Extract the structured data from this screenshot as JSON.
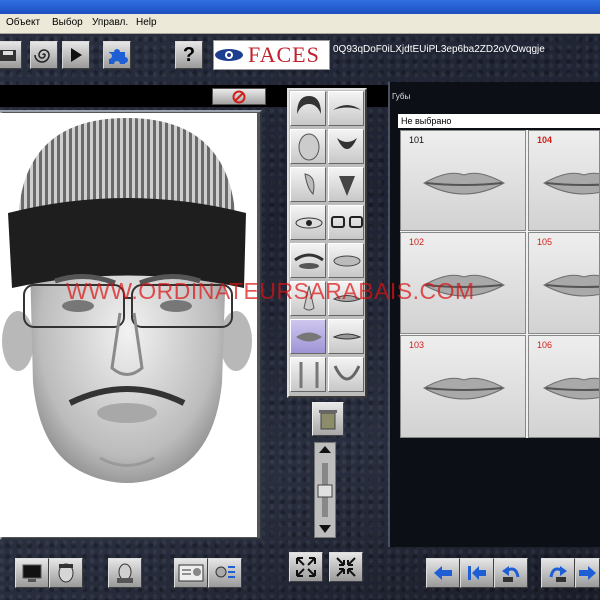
{
  "menu": {
    "items": [
      "Объект",
      "Выбор",
      "Управл.",
      "Help"
    ]
  },
  "toolbar": {
    "logo_text": "FACES",
    "code": "0Q93qDoF0iLXjdtEUiPL3ep6ba2ZD2oVOwqgje"
  },
  "panel": {
    "title": "Губы",
    "select_value": "Не выбрано"
  },
  "tiles": [
    {
      "num": "101",
      "selected": false
    },
    {
      "num": "104",
      "selected": true
    },
    {
      "num": "102",
      "selected": false
    },
    {
      "num": "105",
      "selected": false
    },
    {
      "num": "103",
      "selected": false
    },
    {
      "num": "106",
      "selected": false
    }
  ],
  "watermark": "WWW.ORDINATEURSARABAIS.COM",
  "colors": {
    "accent_red": "#c2202b",
    "num_red": "#d0201a",
    "panel_bg": "#0d0f16"
  },
  "icons": {
    "categories": [
      "hair-icon",
      "moustache-icon",
      "head-shape-icon",
      "beard-icon",
      "ear-icon",
      "chin-icon",
      "eyes-icon",
      "glasses-icon",
      "eyebrows-icon",
      "mouth-closed-icon",
      "nose-icon",
      "lips-bottom-icon",
      "lips-icon",
      "lip-shape-icon",
      "neck-icon",
      "jaw-icon"
    ]
  }
}
